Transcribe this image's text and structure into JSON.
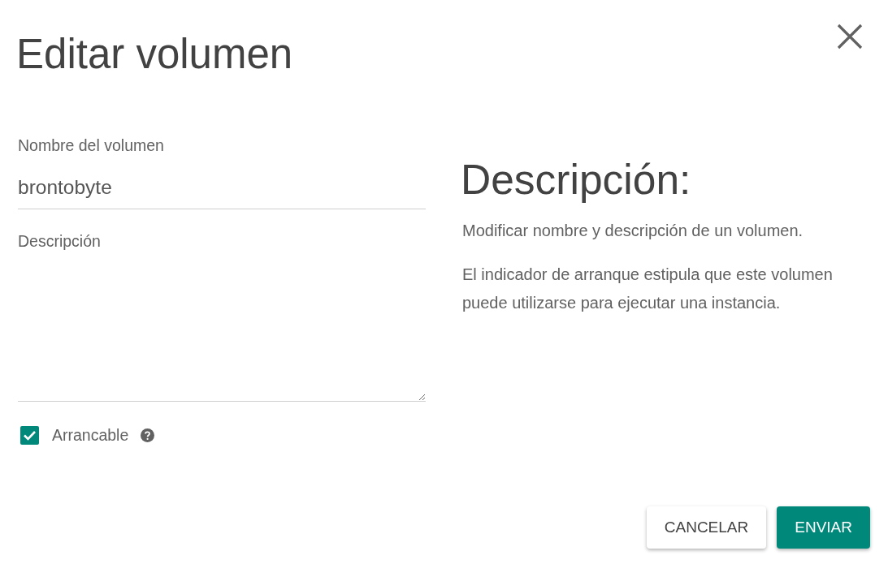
{
  "dialog": {
    "title": "Editar volumen"
  },
  "form": {
    "fields": [
      {
        "kind": "text",
        "label": "Nombre del volumen",
        "value": "brontobyte"
      },
      {
        "kind": "textarea",
        "label": "Descripción"
      }
    ],
    "checkbox": {
      "label": "Arrancable",
      "checked": true
    }
  },
  "help": {
    "heading": "Descripción:",
    "paragraphs": [
      "Modificar nombre y descripción de un volumen.",
      "El indicador de arranque estipula que este volumen puede utilizarse para ejecutar una instancia."
    ]
  },
  "buttons": [
    {
      "kind": "secondary",
      "label": "CANCELAR"
    },
    {
      "kind": "primary",
      "label": "ENVIAR"
    }
  ]
}
